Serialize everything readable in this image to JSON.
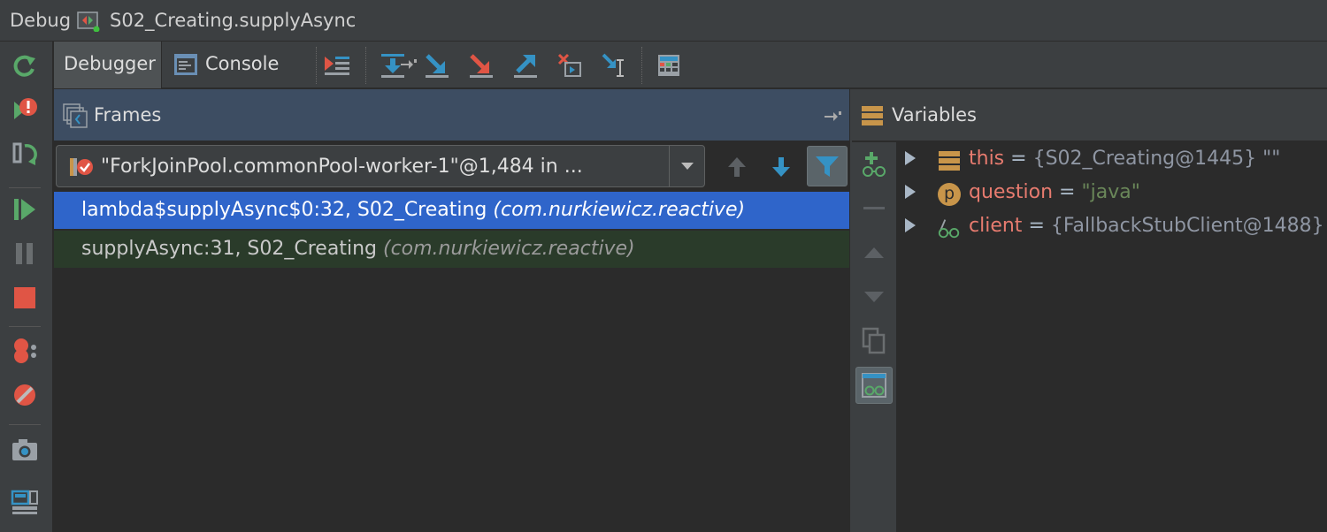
{
  "titlebar": {
    "tool_window": "Debug",
    "config_name": "S02_Creating.supplyAsync"
  },
  "left_toolbar": {
    "icons": [
      "rerun-icon",
      "restart-exception-icon",
      "rerun-modified-icon",
      "resume-icon",
      "pause-icon",
      "stop-icon",
      "view-breakpoints-icon",
      "mute-breakpoints-icon",
      "screenshot-icon",
      "layout-icon"
    ]
  },
  "tabs": {
    "debugger": "Debugger",
    "console": "Console"
  },
  "frames": {
    "title": "Frames",
    "thread": "\"ForkJoinPool.commonPool-worker-1\"@1,484 in ...",
    "items": [
      {
        "method": "lambda$supplyAsync$0:32, S02_Creating",
        "package": "(com.nurkiewicz.reactive)",
        "selected": true
      },
      {
        "method": "supplyAsync:31, S02_Creating",
        "package": "(com.nurkiewicz.reactive)",
        "selected": false
      }
    ]
  },
  "variables": {
    "title": "Variables",
    "items": [
      {
        "name": "this",
        "eq": "=",
        "value": "{S02_Creating@1445} \"\"",
        "icon": "object-fields-icon"
      },
      {
        "name": "question",
        "eq": "=",
        "value": "\"java\"",
        "icon": "parameter-icon",
        "icon_letter": "p"
      },
      {
        "name": "client",
        "eq": "=",
        "value": "{FallbackStubClient@1488}",
        "icon": "watch-glasses-icon"
      }
    ]
  },
  "colors": {
    "selected_row": "#2f65ca",
    "second_row": "#2a3b2a",
    "frames_header": "#3d4d62",
    "accent_blue": "#3592c4"
  }
}
